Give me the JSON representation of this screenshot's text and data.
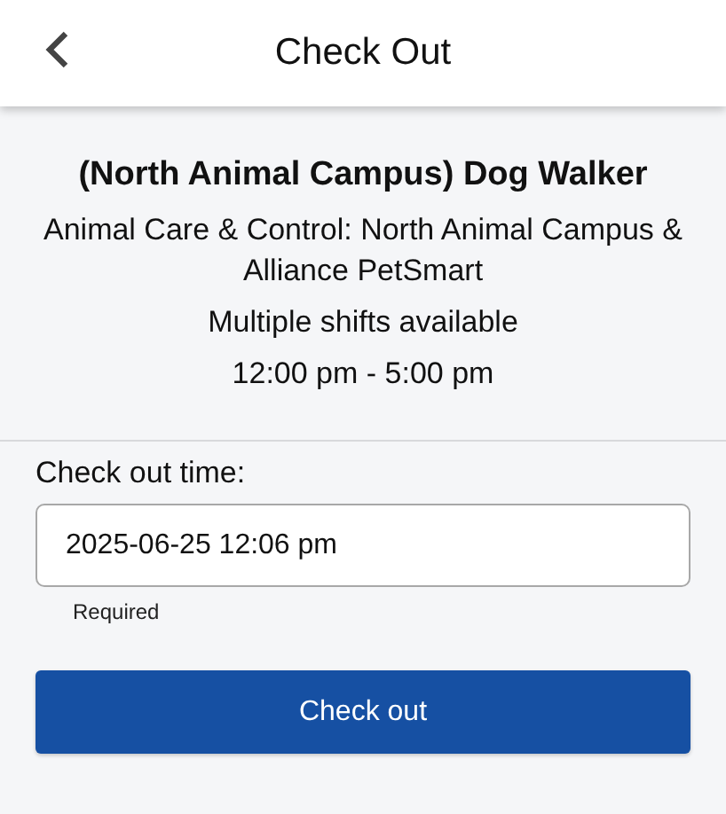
{
  "header": {
    "title": "Check Out"
  },
  "opportunity": {
    "title": "(North Animal Campus) Dog Walker",
    "organization": "Animal Care & Control: North Animal Campus & Alliance PetSmart",
    "shifts": "Multiple shifts available",
    "hours": "12:00 pm - 5:00 pm"
  },
  "form": {
    "label": "Check out time:",
    "value": "2025-06-25 12:06 pm",
    "hint": "Required",
    "button": "Check out"
  }
}
